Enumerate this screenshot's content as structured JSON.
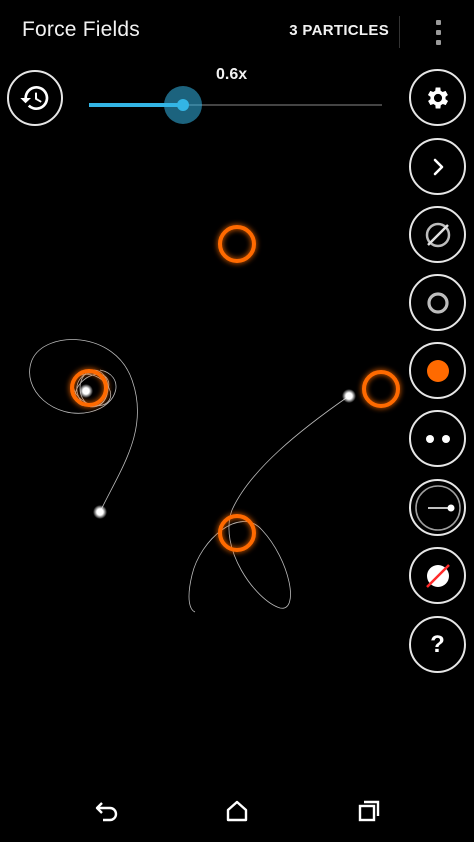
{
  "appbar": {
    "title": "Force Fields",
    "particle_count": "3 PARTICLES",
    "overflow_icon": "more-vert-icon"
  },
  "speed": {
    "label": "0.6x",
    "value": 0.6,
    "fill_fraction": 0.32
  },
  "colors": {
    "accent": "#33b5e5",
    "field": "#ff6a00",
    "outline": "#e6e6e6",
    "background": "#000000"
  },
  "toolbar": {
    "history_icon": "history-icon",
    "buttons": [
      {
        "name": "settings-button",
        "icon": "gear-icon"
      },
      {
        "name": "next-button",
        "icon": "chevron-right-icon"
      },
      {
        "name": "tool-empty-field",
        "icon": "slashed-circle-icon"
      },
      {
        "name": "tool-ring-field",
        "icon": "ring-icon"
      },
      {
        "name": "tool-attractor",
        "icon": "orange-dot-icon"
      },
      {
        "name": "tool-particles",
        "icon": "two-dots-icon"
      },
      {
        "name": "tool-launcher",
        "icon": "launcher-icon"
      },
      {
        "name": "tool-remove-field",
        "icon": "no-field-icon"
      },
      {
        "name": "help-button",
        "icon": "question-icon",
        "label": "?"
      }
    ]
  },
  "navbar": {
    "back_icon": "back-icon",
    "home_icon": "home-icon",
    "recents_icon": "recents-icon"
  }
}
